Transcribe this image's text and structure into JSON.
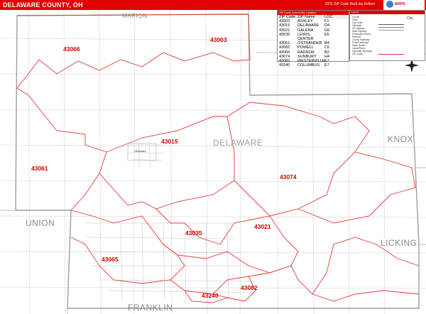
{
  "header": {
    "title": "DELAWARE COUNTY, OH",
    "edition": "2021 ZIP Code RedLine Edition"
  },
  "logo": {
    "text": "MAPS"
  },
  "zip_table": {
    "title": "ZIP Code Index/Grid Location",
    "columns": [
      "ZIP Code",
      "ZIP Name",
      "LOC"
    ],
    "rows": [
      [
        "43003",
        "ASHLEY",
        "F1"
      ],
      [
        "43015",
        "DELAWARE",
        "D4"
      ],
      [
        "43021",
        "GALENA",
        "G6"
      ],
      [
        "43035",
        "LEWIS CENTER",
        "E5"
      ],
      [
        "43061",
        "OSTRANDER",
        "B4"
      ],
      [
        "43065",
        "POWELL",
        "C6"
      ],
      [
        "43066",
        "RADNOR",
        "B2"
      ],
      [
        "43074",
        "SUNBURY",
        "H4"
      ],
      [
        "43082",
        "WESTERVILLE",
        "E7"
      ],
      [
        "43240",
        "COLUMBUS",
        "E7"
      ]
    ]
  },
  "legend": {
    "title": "Legend",
    "items": [
      "County",
      "Cities",
      "City Limits",
      "Interstate",
      "US Highway",
      "State Highway",
      "Secondary Streets",
      "Railroad",
      "County Highways",
      "Parks/Landmark",
      "Water Bodies",
      "Lakes/Rivers",
      "Interstate Highways",
      "ZIP Codes"
    ],
    "label_city": "City",
    "colors": {
      "zip_boundary": "#e53935",
      "county_boundary": "#9e9e9e",
      "header": "#e00000"
    }
  },
  "county_labels": {
    "delaware": "DELAWARE",
    "marion": "MARION",
    "knox": "KNOX",
    "union": "UNION",
    "licking": "LICKING",
    "franklin": "FRANKLIN"
  },
  "zip_labels": {
    "z43003": "43003",
    "z43066": "43066",
    "z43015": "43015",
    "z43061": "43061",
    "z43074": "43074",
    "z43035": "43035",
    "z43021": "43021",
    "z43065": "43065",
    "z43082": "43082",
    "z43240": "43240"
  },
  "place_labels": {
    "delaware_city": "Delaware"
  }
}
